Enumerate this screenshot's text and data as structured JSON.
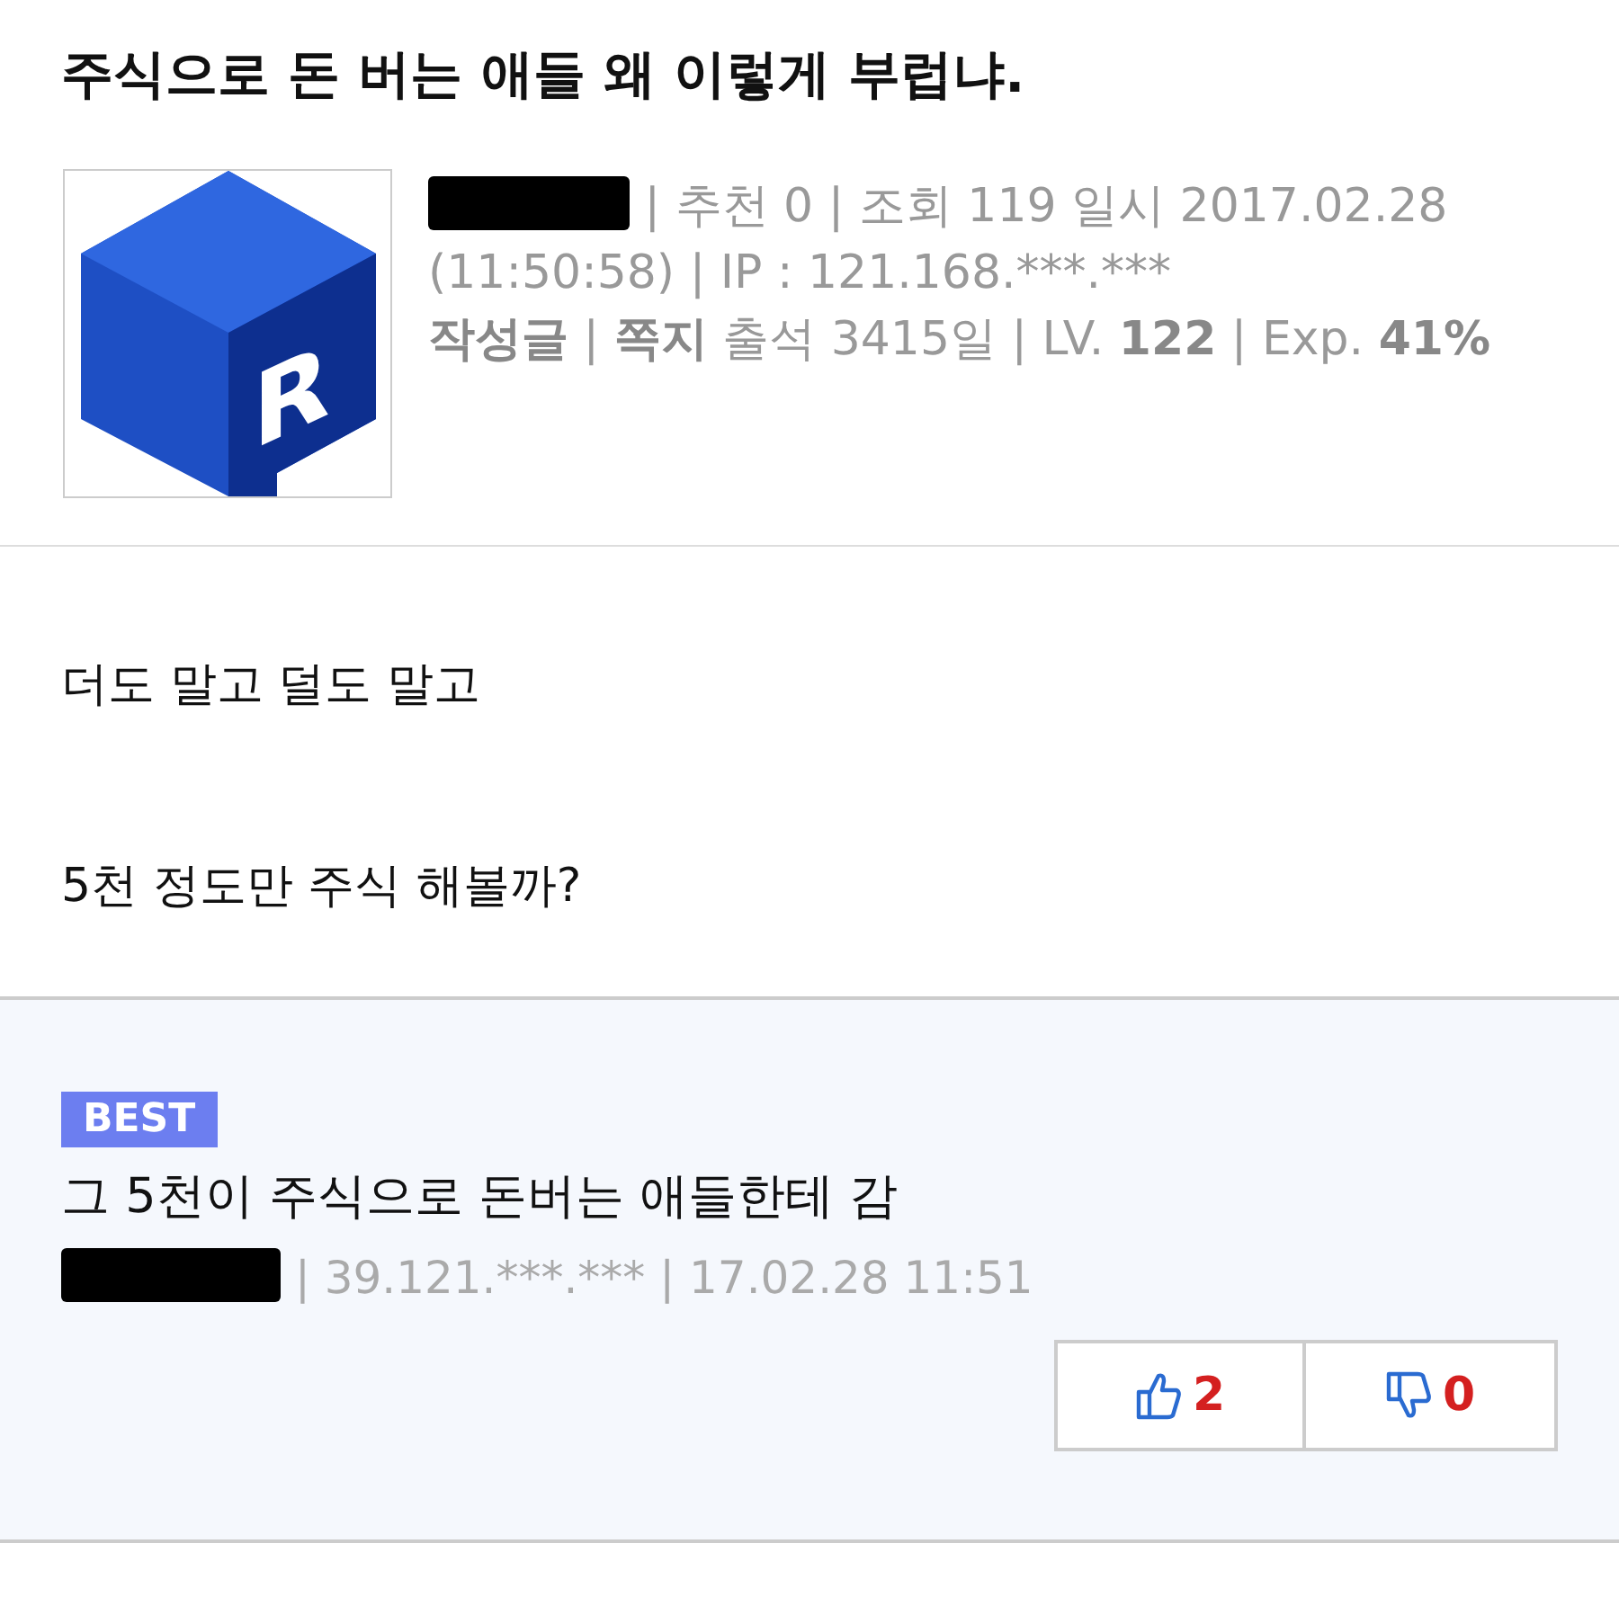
{
  "post": {
    "title": "주식으로 돈 버는 애들 왜 이렇게 부럽냐.",
    "author": {
      "avatar_letter": "R",
      "name_redacted": true,
      "meta": "| 추천 0 | 조회 119 일시 2017.02.28 (11:50:58) | IP : 121.168.***.***",
      "member": "**작성글** | **쪽지** 출석 3415일 |  LV. **122**  | Exp. **41%**"
    },
    "body": [
      "더도 말고 덜도 말고",
      "5천 정도만 주식 해볼까?"
    ]
  },
  "best_comment": {
    "badge": "BEST",
    "text": "그 5천이 주식으로 돈버는 애들한테 감",
    "name_redacted": true,
    "meta": "| 39.121.***.*** | 17.02.28 11:51",
    "votes": [
      {
        "kind": "up",
        "count": "2"
      },
      {
        "kind": "down",
        "count": "0"
      }
    ]
  }
}
